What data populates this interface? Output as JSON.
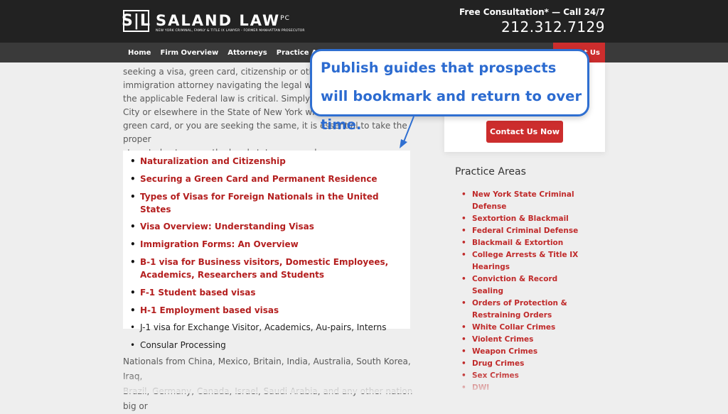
{
  "header": {
    "logo_initials": "S|L",
    "logo_name": "SALAND LAW",
    "logo_suffix": "PC",
    "logo_tagline": "NEW YORK CRIMINAL, FAMILY & TITLE IX LAWYER - FORMER MANHATTAN PROSECUTOR",
    "consultation": "Free Consultation* — Call 24/7",
    "phone": "212.312.7129"
  },
  "nav": {
    "items": [
      "Home",
      "Firm Overview",
      "Attorneys",
      "Practice Areas"
    ],
    "cta_partial": "t Us"
  },
  "article": {
    "intro_lines": [
      "seeking a visa, green card, citizenship or other le",
      "immigration attorney navigating the legal water",
      "the applicable Federal law is critical. Simply, whe",
      "City or elsewhere in the State of New York with a",
      "green card, or you are seeking the same, it is essential to take the proper",
      "steps to best secure the legal status you seek."
    ],
    "guide_list": [
      {
        "label": "Naturalization and Citizenship",
        "link": true
      },
      {
        "label": "Securing a Green Card and Permanent Residence",
        "link": true
      },
      {
        "label": "Types of Visas for Foreign Nationals in the United States",
        "link": true
      },
      {
        "label": "Visa Overview: Understanding Visas",
        "link": true
      },
      {
        "label": "Immigration Forms: An Overview",
        "link": true
      },
      {
        "label": "B-1 visa for Business visitors, Domestic Employees, Academics, Researchers and Students",
        "link": true
      },
      {
        "label": "F-1 Student based visas",
        "link": true
      },
      {
        "label": "H-1 Employment based visas",
        "link": true
      },
      {
        "label": "J-1 visa for Exchange Visitor, Academics, Au-pairs, Interns",
        "link": false
      },
      {
        "label": "Consular Processing",
        "link": false
      }
    ],
    "outro_lines": [
      "Nationals from China, Mexico, Britain, India, Australia, South Korea, Iraq,",
      "Brazil, Germany, Canada, Israel, Saudi Arabia, and any other nation big or"
    ]
  },
  "sidebar": {
    "contact_button": "Contact Us Now",
    "practice_title": "Practice Areas",
    "practice_areas": [
      "New York State Criminal Defense",
      "Sextortion & Blackmail",
      "Federal Criminal Defense",
      "Blackmail & Extortion",
      "College Arrests & Title IX Hearings",
      "Conviction & Record Sealing",
      "Orders of Protection & Restraining Orders",
      "White Collar Crimes",
      "Violent Crimes",
      "Weapon Crimes",
      "Drug Crimes",
      "Sex Crimes",
      "DWI"
    ]
  },
  "callout": {
    "text": "Publish guides that prospects will bookmark and return to over time."
  },
  "colors": {
    "header_bg": "#222222",
    "nav_bg": "#3a3a3a",
    "brand_red": "#cc2d2d",
    "link_red": "#b41f1f",
    "callout_blue": "#2f6fd1"
  }
}
